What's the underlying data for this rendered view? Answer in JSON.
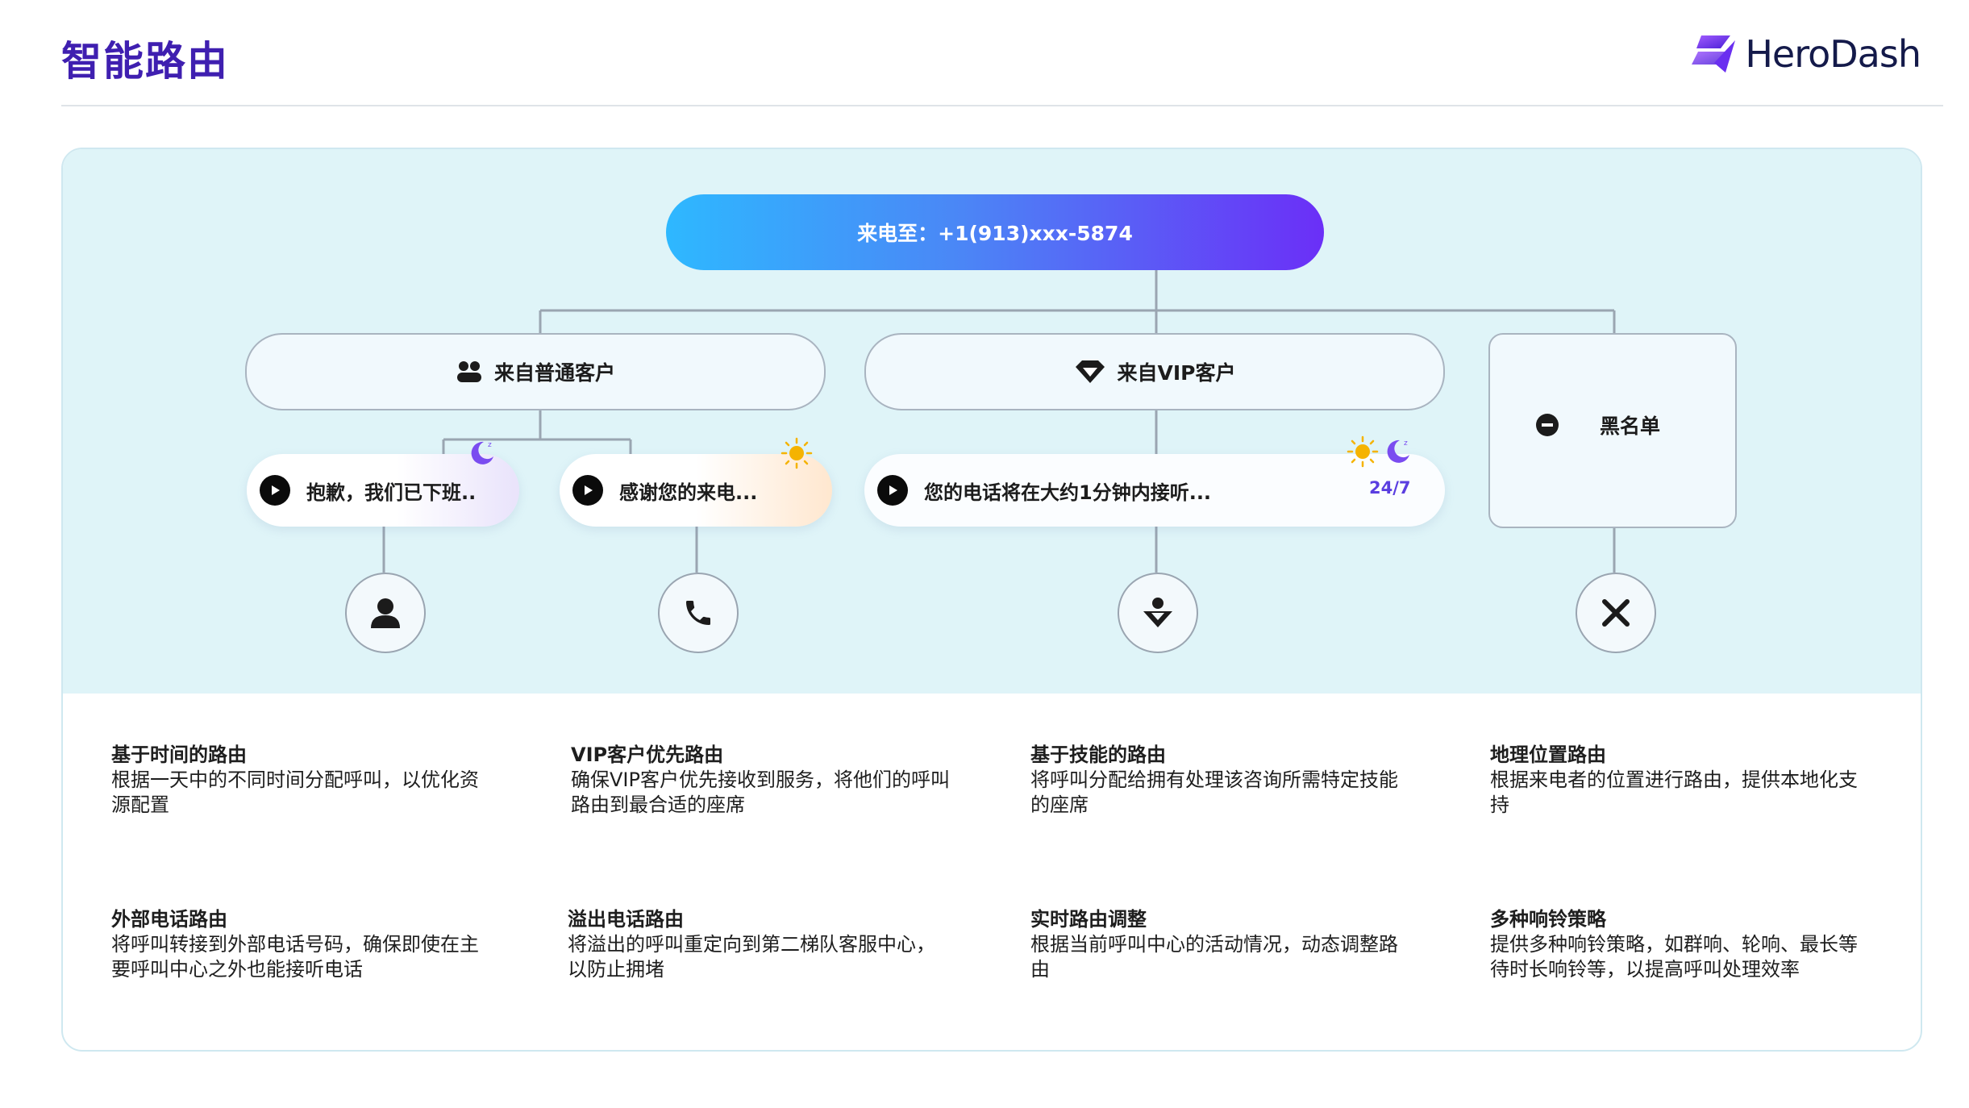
{
  "header": {
    "title": "智能路由",
    "logo_text": "HeroDash"
  },
  "diagram": {
    "incoming": "来电至：+1(913)xxx-5874",
    "groups": [
      {
        "label": "来自普通客户",
        "icon": "users-icon"
      },
      {
        "label": "来自VIP客户",
        "icon": "diamond-icon"
      }
    ],
    "blacklist": {
      "label": "黑名单",
      "icon": "minus-circle-icon"
    },
    "messages": [
      {
        "text": "抱歉，我们已下班..",
        "badge": "moon-icon"
      },
      {
        "text": "感谢您的来电...",
        "badge": "sun-icon"
      },
      {
        "text": "您的电话将在大约1分钟内接听...",
        "badges": [
          "sun-icon",
          "moon-icon"
        ],
        "tag": "24/7"
      }
    ],
    "endpoints": [
      "agent-icon",
      "phone-icon",
      "vip-agent-icon",
      "reject-icon"
    ]
  },
  "features": [
    {
      "title": "基于时间的路由",
      "desc": "根据一天中的不同时间分配呼叫，以优化资源配置"
    },
    {
      "title": "VIP客户优先路由",
      "desc": "确保VIP客户优先接收到服务，将他们的呼叫路由到最合适的座席"
    },
    {
      "title": "基于技能的路由",
      "desc": "将呼叫分配给拥有处理该咨询所需特定技能的座席"
    },
    {
      "title": "地理位置路由",
      "desc": "根据来电者的位置进行路由，提供本地化支持"
    },
    {
      "title": "外部电话路由",
      "desc": "将呼叫转接到外部电话号码，确保即使在主要呼叫中心之外也能接听电话"
    },
    {
      "title": "溢出电话路由",
      "desc": "将溢出的呼叫重定向到第二梯队客服中心，以防止拥堵"
    },
    {
      "title": "实时路由调整",
      "desc": "根据当前呼叫中心的活动情况，动态调整路由"
    },
    {
      "title": "多种响铃策略",
      "desc": "提供多种响铃策略，如群响、轮响、最长等待时长响铃等，以提高呼叫处理效率"
    }
  ],
  "colors": {
    "title": "#3f1fb0",
    "panel_bg": "#dff4f8",
    "gradient_start": "#2eb8ff",
    "gradient_end": "#6b2ff7",
    "moon": "#7a4cf0",
    "sun": "#f5b300",
    "line": "#9aa5b1"
  }
}
